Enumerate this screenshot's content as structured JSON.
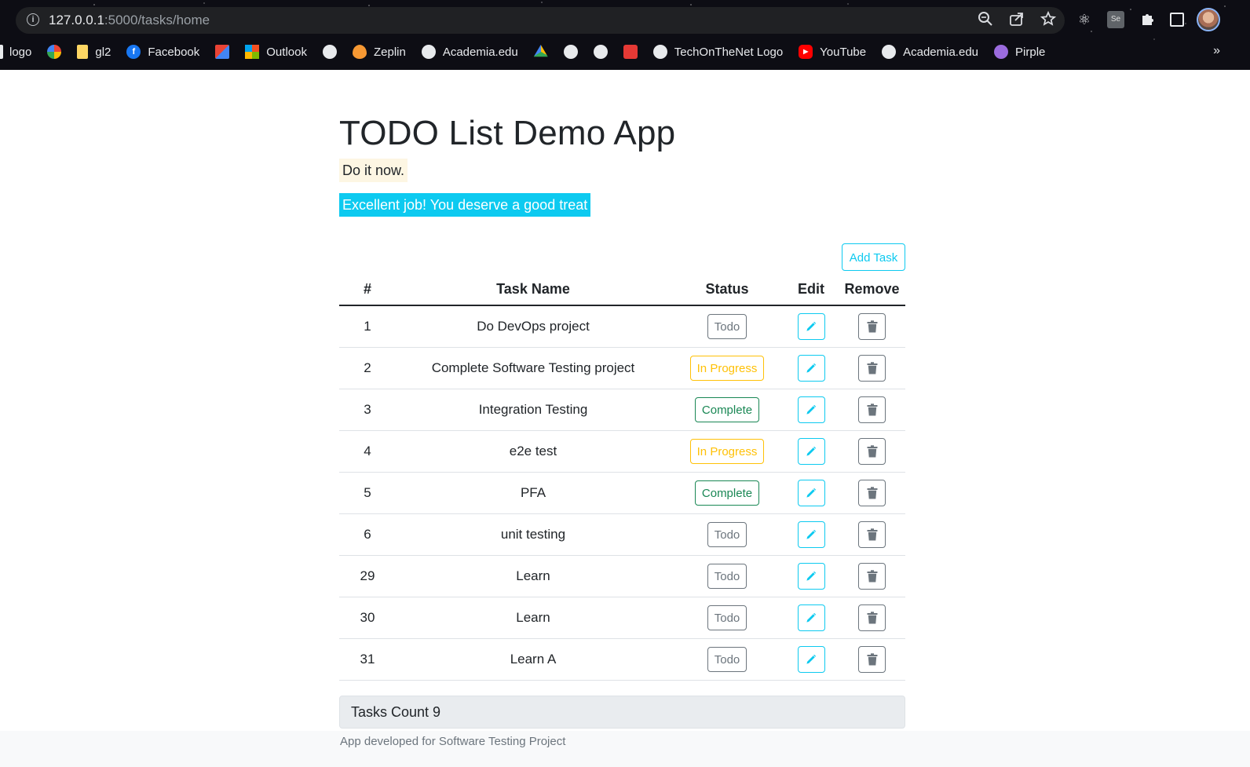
{
  "browser": {
    "url_host": "127.0.0.1",
    "url_path": ":5000/tasks/home",
    "bookmarks": [
      {
        "label": "logo",
        "icon": "page-icon"
      },
      {
        "label": "",
        "icon": "pinwheel-icon"
      },
      {
        "label": "gl2",
        "icon": "folder-icon"
      },
      {
        "label": "Facebook",
        "icon": "facebook-icon"
      },
      {
        "label": "",
        "icon": "gmail-icon"
      },
      {
        "label": "Outlook",
        "icon": "windows-icon"
      },
      {
        "label": "",
        "icon": "github-icon"
      },
      {
        "label": "Zeplin",
        "icon": "zeplin-icon"
      },
      {
        "label": "Academia.edu",
        "icon": "globe-icon"
      },
      {
        "label": "",
        "icon": "drive-icon"
      },
      {
        "label": "",
        "icon": "globe-icon"
      },
      {
        "label": "",
        "icon": "globe-icon"
      },
      {
        "label": "",
        "icon": "grid-icon"
      },
      {
        "label": "TechOnTheNet Logo",
        "icon": "globe-icon"
      },
      {
        "label": "YouTube",
        "icon": "youtube-icon"
      },
      {
        "label": "Academia.edu",
        "icon": "globe-icon"
      },
      {
        "label": "Pirple",
        "icon": "pirple-icon"
      }
    ],
    "more": "»"
  },
  "app": {
    "title": "TODO List Demo App",
    "tagline": "Do it now.",
    "alert": "Excellent job! You deserve a good treat",
    "add_task_label": "Add Task",
    "columns": [
      "#",
      "Task Name",
      "Status",
      "Edit",
      "Remove"
    ],
    "tasks": [
      {
        "id": "1",
        "name": "Do DevOps project",
        "status": "Todo"
      },
      {
        "id": "2",
        "name": "Complete Software Testing project",
        "status": "In Progress"
      },
      {
        "id": "3",
        "name": "Integration Testing",
        "status": "Complete"
      },
      {
        "id": "4",
        "name": "e2e test",
        "status": "In Progress"
      },
      {
        "id": "5",
        "name": "PFA",
        "status": "Complete"
      },
      {
        "id": "6",
        "name": "unit testing",
        "status": "Todo"
      },
      {
        "id": "29",
        "name": "Learn",
        "status": "Todo"
      },
      {
        "id": "30",
        "name": "Learn",
        "status": "Todo"
      },
      {
        "id": "31",
        "name": "Learn A",
        "status": "Todo"
      }
    ],
    "tasks_count": "Tasks Count 9",
    "footer": "App developed for Software Testing Project"
  },
  "colors": {
    "info": "#0dcaf0",
    "todo": "#6c757d",
    "in_progress": "#ffc107",
    "complete": "#198754"
  }
}
